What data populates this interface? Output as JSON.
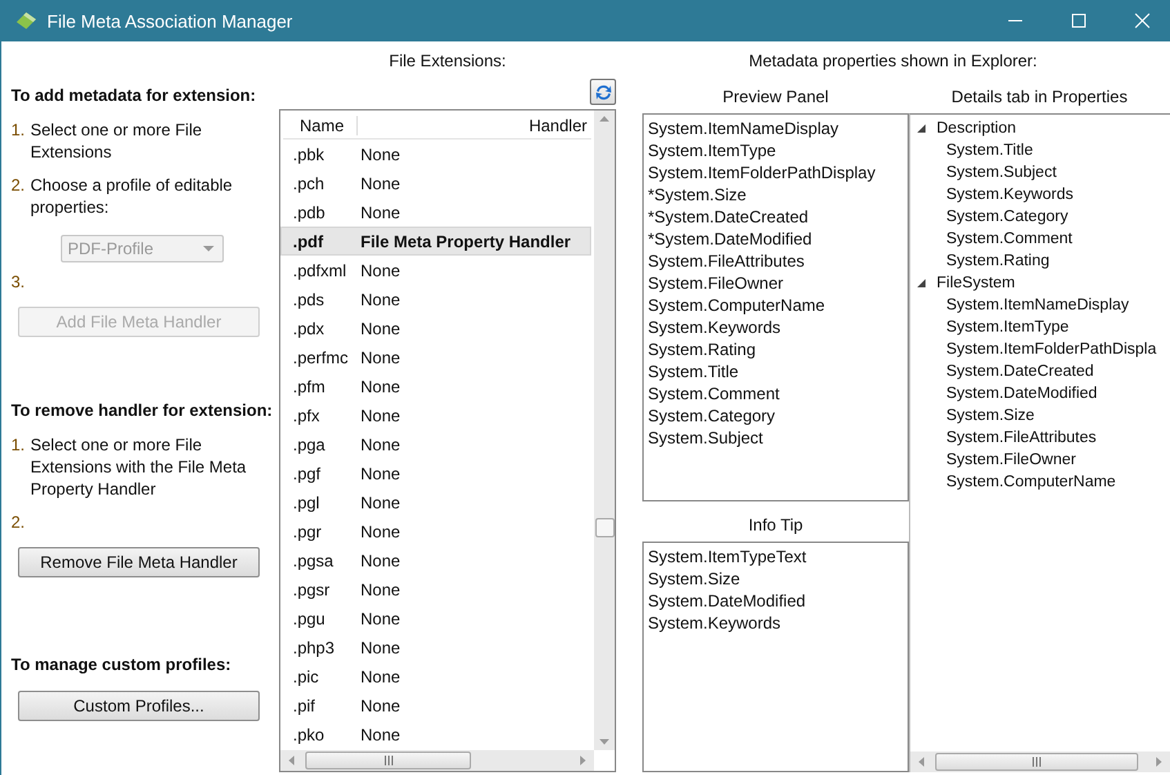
{
  "window": {
    "title": "File Meta Association Manager"
  },
  "instructions": {
    "add_heading": "To add metadata for extension:",
    "add_steps": [
      {
        "number": "1.",
        "text": "Select one or more File Extensions"
      },
      {
        "number": "2.",
        "text": "Choose a profile of editable properties:"
      },
      {
        "number": "3."
      }
    ],
    "profile_dropdown": {
      "value": "PDF-Profile",
      "disabled": true
    },
    "add_button": {
      "label": "Add File Meta Handler",
      "disabled": true
    },
    "remove_heading": "To remove handler for extension:",
    "remove_steps": [
      {
        "number": "1.",
        "text": "Select one or more File Extensions with the File Meta Property Handler"
      },
      {
        "number": "2."
      }
    ],
    "remove_button": {
      "label": "Remove File Meta Handler",
      "disabled": false
    },
    "profiles_heading": "To manage custom profiles:",
    "profiles_button": {
      "label": "Custom Profiles...",
      "disabled": false
    }
  },
  "extensions": {
    "title": "File Extensions:",
    "columns": [
      "Name",
      "Handler"
    ],
    "rows": [
      {
        "name": ".pbk",
        "handler": "None",
        "selected": false
      },
      {
        "name": ".pch",
        "handler": "None",
        "selected": false
      },
      {
        "name": ".pdb",
        "handler": "None",
        "selected": false
      },
      {
        "name": ".pdf",
        "handler": "File Meta Property Handler",
        "selected": true
      },
      {
        "name": ".pdfxml",
        "handler": "None",
        "selected": false
      },
      {
        "name": ".pds",
        "handler": "None",
        "selected": false
      },
      {
        "name": ".pdx",
        "handler": "None",
        "selected": false
      },
      {
        "name": ".perfmc",
        "handler": "None",
        "selected": false
      },
      {
        "name": ".pfm",
        "handler": "None",
        "selected": false
      },
      {
        "name": ".pfx",
        "handler": "None",
        "selected": false
      },
      {
        "name": ".pga",
        "handler": "None",
        "selected": false
      },
      {
        "name": ".pgf",
        "handler": "None",
        "selected": false
      },
      {
        "name": ".pgl",
        "handler": "None",
        "selected": false
      },
      {
        "name": ".pgr",
        "handler": "None",
        "selected": false
      },
      {
        "name": ".pgsa",
        "handler": "None",
        "selected": false
      },
      {
        "name": ".pgsr",
        "handler": "None",
        "selected": false
      },
      {
        "name": ".pgu",
        "handler": "None",
        "selected": false
      },
      {
        "name": ".php3",
        "handler": "None",
        "selected": false
      },
      {
        "name": ".pic",
        "handler": "None",
        "selected": false
      },
      {
        "name": ".pif",
        "handler": "None",
        "selected": false
      },
      {
        "name": ".pko",
        "handler": "None",
        "selected": false
      }
    ]
  },
  "metadata": {
    "title": "Metadata properties shown in Explorer:",
    "preview_panel": {
      "title": "Preview Panel",
      "items": [
        "System.ItemNameDisplay",
        "System.ItemType",
        "System.ItemFolderPathDisplay",
        "*System.Size",
        "*System.DateCreated",
        "*System.DateModified",
        "System.FileAttributes",
        "System.FileOwner",
        "System.ComputerName",
        "System.Keywords",
        "System.Rating",
        "System.Title",
        "System.Comment",
        "System.Category",
        "System.Subject"
      ]
    },
    "info_tip": {
      "title": "Info Tip",
      "items": [
        "System.ItemTypeText",
        "System.Size",
        "System.DateModified",
        "System.Keywords"
      ]
    },
    "details_tab": {
      "title": "Details tab in Properties",
      "groups": [
        {
          "label": "Description",
          "expanded": true,
          "children": [
            "System.Title",
            "System.Subject",
            "System.Keywords",
            "System.Category",
            "System.Comment",
            "System.Rating"
          ]
        },
        {
          "label": "FileSystem",
          "expanded": true,
          "children": [
            "System.ItemNameDisplay",
            "System.ItemType",
            "System.ItemFolderPathDispla",
            "System.DateCreated",
            "System.DateModified",
            "System.Size",
            "System.FileAttributes",
            "System.FileOwner",
            "System.ComputerName"
          ]
        }
      ]
    }
  }
}
